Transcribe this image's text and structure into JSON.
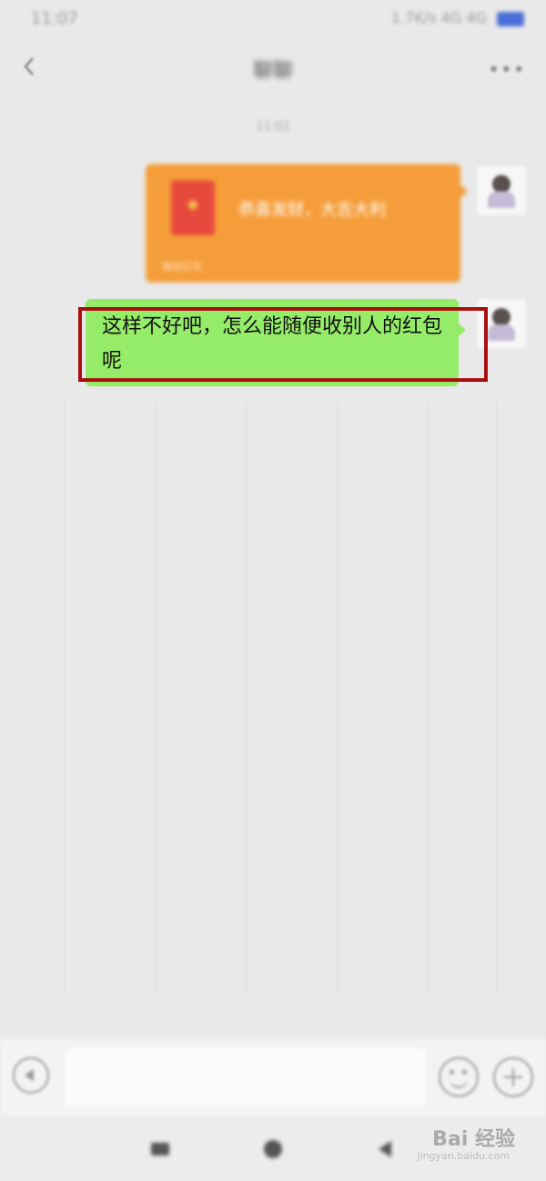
{
  "status_bar": {
    "time": "11:07",
    "right_text": "1.7K/s 4G 4G"
  },
  "header": {
    "title": "聊聊"
  },
  "chat": {
    "timestamp": "11:02",
    "red_packet": {
      "greeting": "恭喜发财，大吉大利",
      "label": "微信红包"
    },
    "message": {
      "text": "这样不好吧，怎么能随便收别人的红包呢"
    }
  },
  "watermark": {
    "brand": "Bai 经验",
    "url": "jingyan.baidu.com"
  },
  "colors": {
    "background": "#e9e9e9",
    "red_packet": "#f59d3a",
    "message_bubble": "#95ec69",
    "highlight": "#a81010"
  },
  "icons": [
    "back-arrow-icon",
    "more-icon",
    "voice-icon",
    "emoji-icon",
    "plus-icon",
    "menu-icon",
    "home-icon",
    "back-triangle-icon"
  ]
}
